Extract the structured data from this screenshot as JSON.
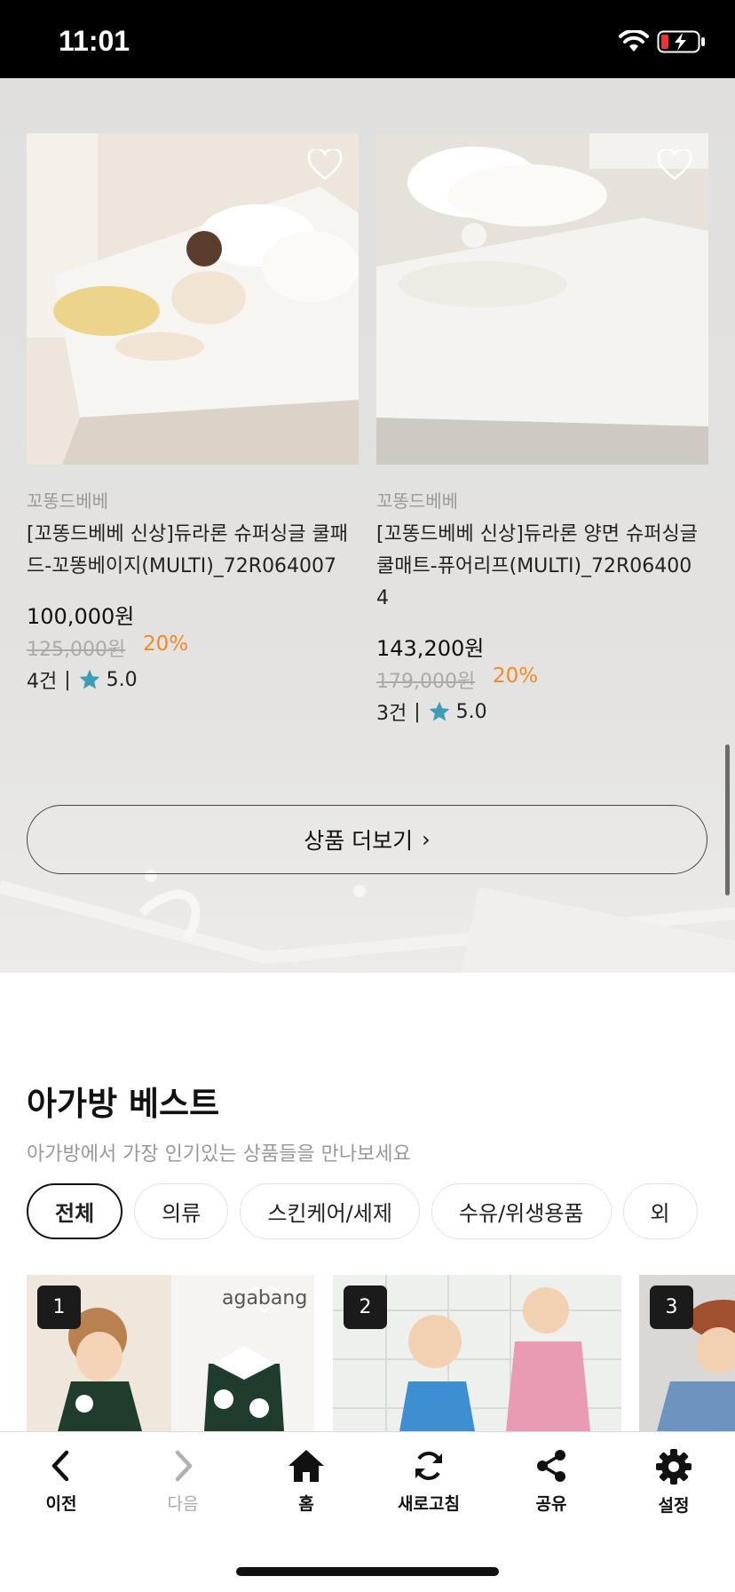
{
  "status_bar": {
    "time": "11:01"
  },
  "products": [
    {
      "brand": "꼬똥드베베",
      "name_line1": "[꼬똥드베베 신상]듀라론 슈퍼싱글 쿨패",
      "name_line2": "드-꼬똥베이지(MULTI)_72R064007",
      "name_line3": "",
      "price": "100,000원",
      "original_price": "125,000원",
      "discount": "20%",
      "review_count": "4건",
      "rating": "5.0"
    },
    {
      "brand": "꼬똥드베베",
      "name_line1": "[꼬똥드베베 신상]듀라론 양면 슈퍼싱글",
      "name_line2": "쿨매트-퓨어리프(MULTI)_72R06400",
      "name_line3": "4",
      "price": "143,200원",
      "original_price": "179,000원",
      "discount": "20%",
      "review_count": "3건",
      "rating": "5.0"
    }
  ],
  "more_button": {
    "label": "상품 더보기",
    "chevron": "›"
  },
  "best": {
    "title": "아가방 베스트",
    "subtitle": "아가방에서 가장 인기있는 상품들을 만나보세요",
    "chips": [
      "전체",
      "의류",
      "스킨케어/세제",
      "수유/위생용품",
      "외"
    ],
    "active_chip": "전체",
    "ranks": [
      "1",
      "2",
      "3"
    ],
    "brand_logo": "agabang"
  },
  "bottom_nav": {
    "items": [
      {
        "label": "이전",
        "icon": "chevron-left-icon",
        "enabled": true
      },
      {
        "label": "다음",
        "icon": "chevron-right-icon",
        "enabled": false
      },
      {
        "label": "홈",
        "icon": "home-icon",
        "enabled": true
      },
      {
        "label": "새로고침",
        "icon": "refresh-icon",
        "enabled": true
      },
      {
        "label": "공유",
        "icon": "share-icon",
        "enabled": true
      },
      {
        "label": "설정",
        "icon": "gear-icon",
        "enabled": true
      }
    ]
  },
  "colors": {
    "discount": "#f08a24",
    "star": "#3d9db8",
    "rank_badge": "#1b1b1b"
  }
}
